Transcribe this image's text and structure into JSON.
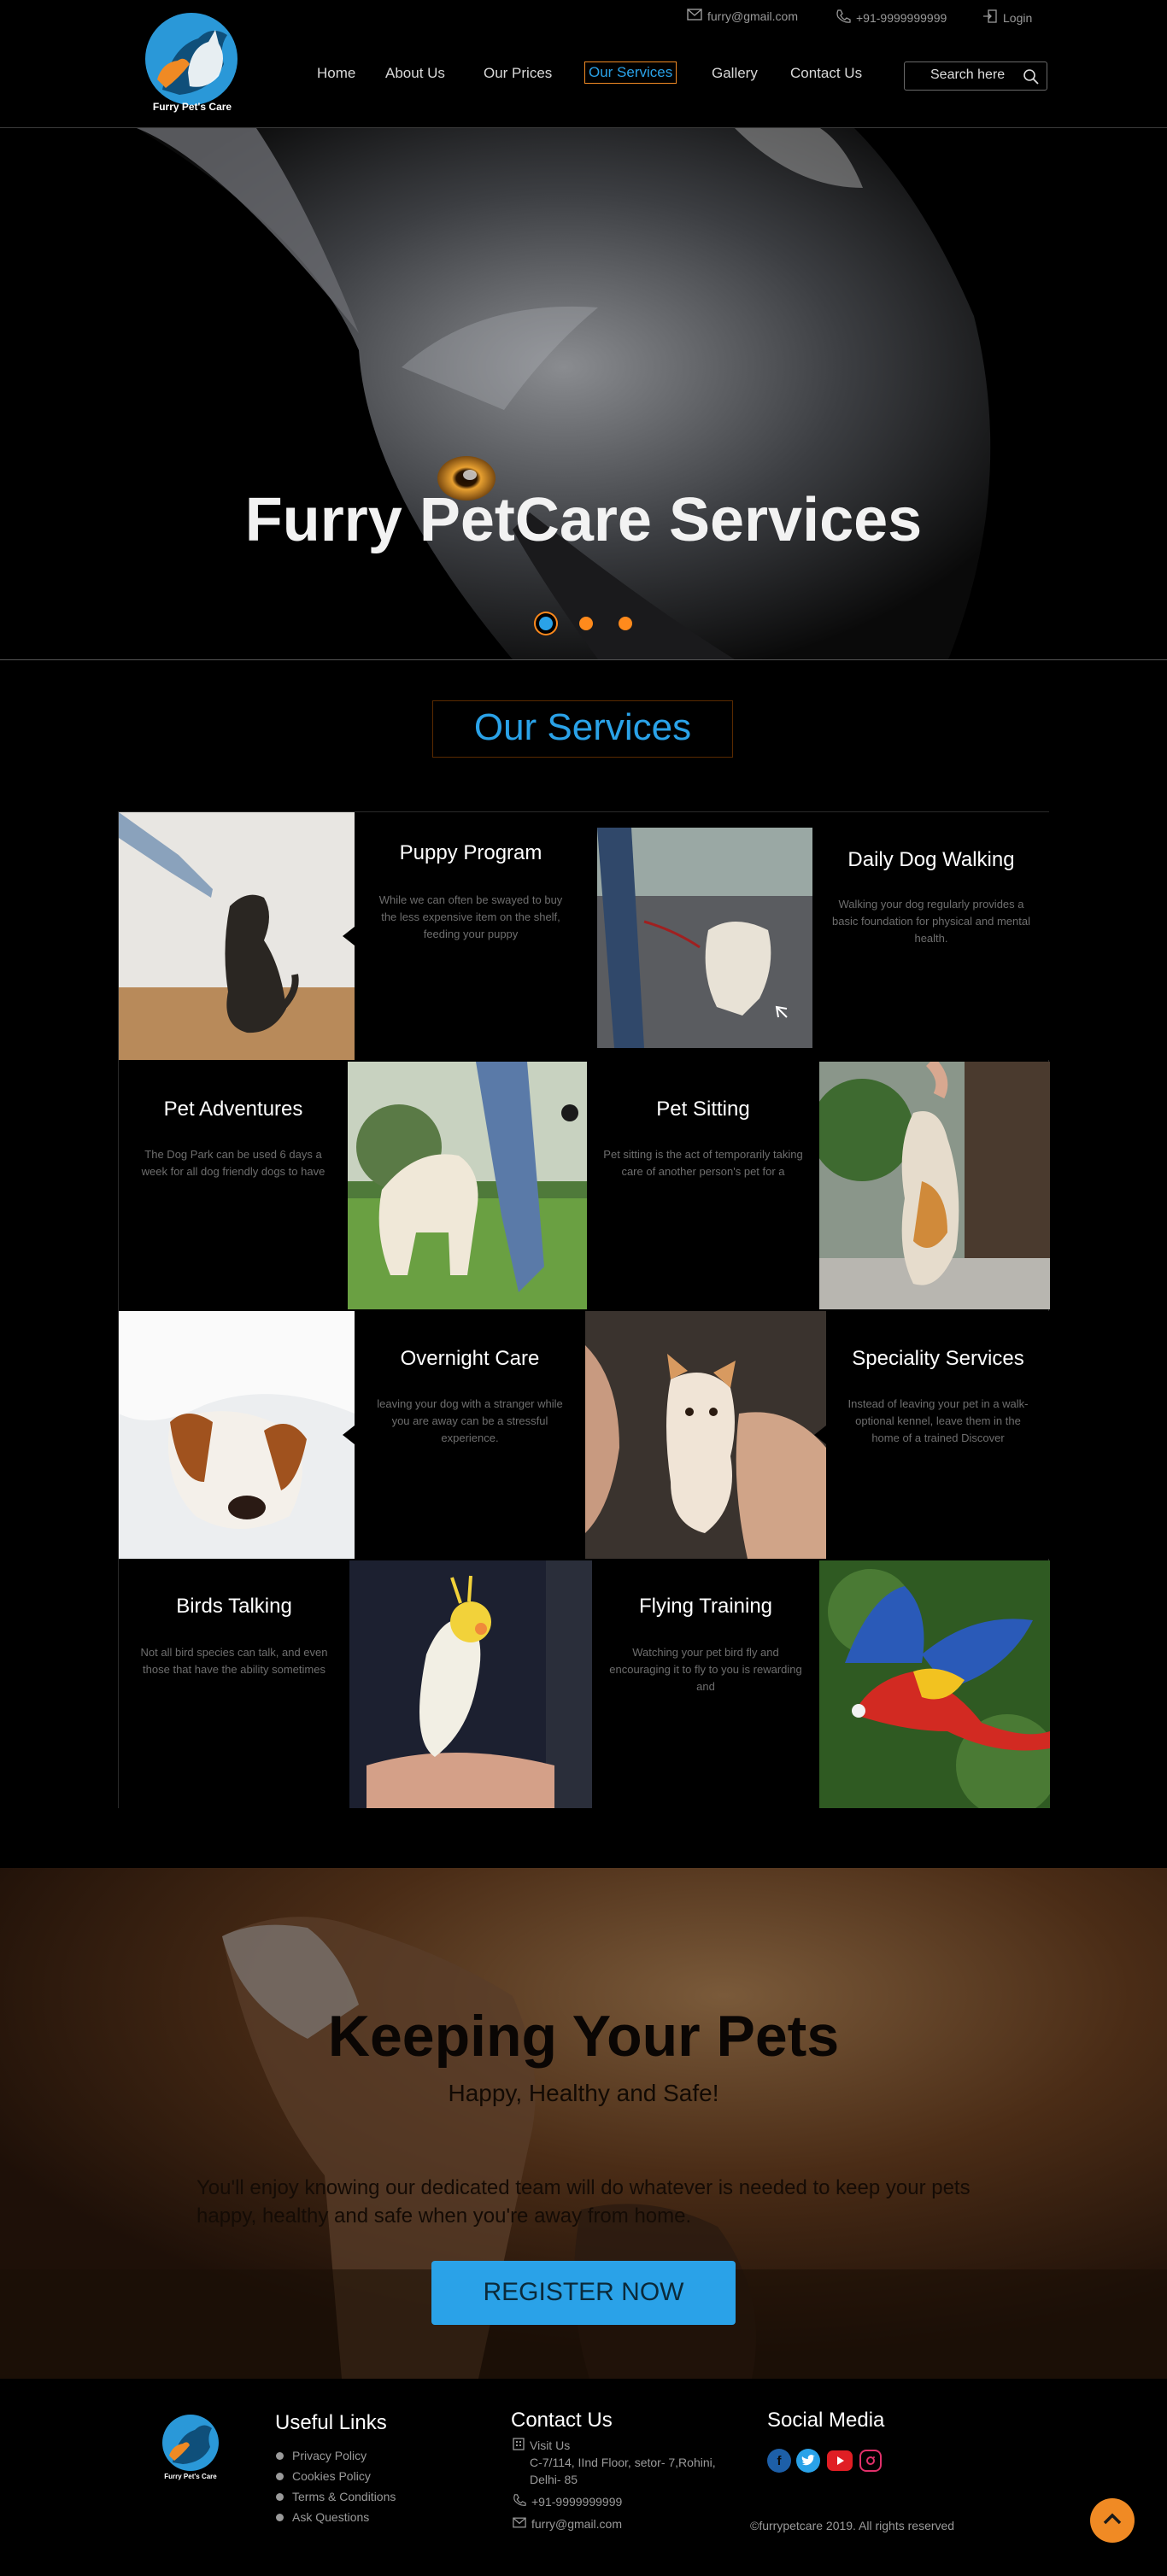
{
  "header": {
    "logo_text": "Furry Pet's Care",
    "email": "furry@gmail.com",
    "phone": "+91-9999999999",
    "login": "Login",
    "nav": [
      "Home",
      "About Us",
      "Our Prices",
      "Our Services",
      "Gallery",
      "Contact Us"
    ],
    "active_nav": "Our Services",
    "search_placeholder": "Search here"
  },
  "hero": {
    "title": "Furry PetCare Services"
  },
  "services": {
    "title": "Our Services",
    "items": [
      {
        "title": "Puppy Program",
        "text": "While we can often be swayed to buy the less expensive item on the shelf, feeding your puppy"
      },
      {
        "title": "Daily Dog Walking",
        "text": "Walking your dog regularly provides a basic foundation for physical and mental health."
      },
      {
        "title": "Pet Adventures",
        "text": "The Dog Park can be used 6 days a week for all dog friendly dogs to have"
      },
      {
        "title": "Pet Sitting",
        "text": "Pet sitting is the act of temporarily taking care of another person's pet for a"
      },
      {
        "title": "Overnight Care",
        "text": "leaving your dog with a stranger while you are away can be a stressful experience."
      },
      {
        "title": "Speciality Services",
        "text": "Instead of leaving your pet in a walk-optional kennel, leave them in the home of a trained Discover"
      },
      {
        "title": "Birds Talking",
        "text": "Not all bird species can talk, and even those that have the ability sometimes"
      },
      {
        "title": "Flying Training",
        "text": "Watching your pet bird fly and encouraging it to fly to you is rewarding and"
      }
    ]
  },
  "banner": {
    "title": "Keeping Your Pets",
    "subtitle": "Happy, Healthy and Safe!",
    "text": "You'll enjoy knowing our dedicated team will do whatever is needed to keep your pets happy, healthy and safe when you're away from home.",
    "button": "REGISTER NOW"
  },
  "footer": {
    "logo_text": "Furry Pet's Care",
    "useful_links_title": "Useful Links",
    "useful_links": [
      "Privacy Policy",
      "Cookies Policy",
      "Terms & Conditions",
      "Ask Questions"
    ],
    "contact_title": "Contact Us",
    "visit_label": "Visit Us",
    "address": "C-7/114, IInd Floor, setor- 7,Rohini, Delhi- 85",
    "phone": "+91-9999999999",
    "email": "furry@gmail.com",
    "social_title": "Social Media",
    "copyright": "©furrypetcare 2019. All rights reserved"
  },
  "colors": {
    "accent_blue": "#2aa2e8",
    "accent_orange": "#f08a24",
    "background": "#000000"
  }
}
